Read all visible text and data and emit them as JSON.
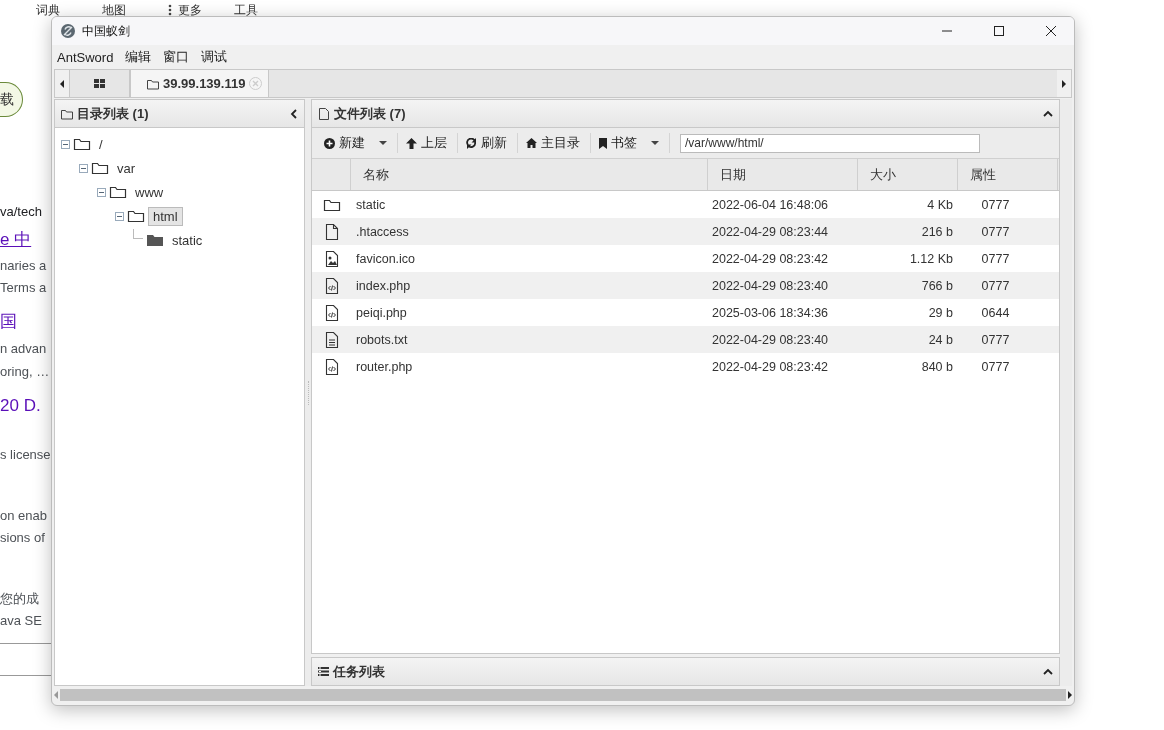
{
  "background_page": {
    "top_links": [
      {
        "label": "词典",
        "kind": "link"
      },
      {
        "label": "地图",
        "kind": "link"
      },
      {
        "label": "更多",
        "kind": "more"
      },
      {
        "label": "工具",
        "kind": "link"
      }
    ],
    "fragments": [
      {
        "text": "载",
        "kind": "pill"
      },
      {
        "text": "va/tech",
        "kind": "url"
      },
      {
        "text": "e 中",
        "kind": "link"
      },
      {
        "text": "naries a",
        "kind": "snippet"
      },
      {
        "text": "Terms a",
        "kind": "snippet"
      },
      {
        "text": "国",
        "kind": "link"
      },
      {
        "text": "n advan",
        "kind": "snippet"
      },
      {
        "text": "oring, …",
        "kind": "snippet"
      },
      {
        "text": "20 D.",
        "kind": "link"
      },
      {
        "text": "s license",
        "kind": "snippet"
      },
      {
        "text": "on enab",
        "kind": "snippet"
      },
      {
        "text": "sions of",
        "kind": "snippet"
      },
      {
        "text": "您的成",
        "kind": "snippet"
      },
      {
        "text": "ava SE",
        "kind": "snippet"
      }
    ]
  },
  "window": {
    "title": "中国蚁剑",
    "menu": [
      "AntSword",
      "编辑",
      "窗口",
      "调试"
    ],
    "tabs": [
      {
        "kind": "home",
        "selected": false
      },
      {
        "kind": "site",
        "label": "39.99.139.119",
        "selected": true
      }
    ],
    "left_panel": {
      "title": "目录列表 (1)",
      "tree": [
        {
          "label": "/",
          "expanded": true,
          "selected": false,
          "children": [
            {
              "label": "var",
              "expanded": true,
              "selected": false,
              "children": [
                {
                  "label": "www",
                  "expanded": true,
                  "selected": false,
                  "children": [
                    {
                      "label": "html",
                      "expanded": true,
                      "selected": true,
                      "children": [
                        {
                          "label": "static",
                          "expanded": false,
                          "selected": false
                        }
                      ]
                    }
                  ]
                }
              ]
            }
          ]
        }
      ]
    },
    "right_panel": {
      "title": "文件列表 (7)",
      "toolbar": [
        {
          "label": "新建",
          "kind": "new",
          "dropdown": true
        },
        {
          "label": "上层",
          "kind": "up",
          "dropdown": false
        },
        {
          "label": "刷新",
          "kind": "refresh",
          "dropdown": false
        },
        {
          "label": "主目录",
          "kind": "home",
          "dropdown": false
        },
        {
          "label": "书签",
          "kind": "bookmark",
          "dropdown": true
        }
      ],
      "path": "/var/www/html/",
      "columns": [
        "名称",
        "日期",
        "大小",
        "属性"
      ],
      "rows": [
        {
          "kind": "folder",
          "name": "static",
          "date": "2022-06-04 16:48:06",
          "size": "4 Kb",
          "perms": "0777"
        },
        {
          "kind": "file",
          "name": ".htaccess",
          "date": "2022-04-29 08:23:44",
          "size": "216 b",
          "perms": "0777"
        },
        {
          "kind": "image",
          "name": "favicon.ico",
          "date": "2022-04-29 08:23:42",
          "size": "1.12 Kb",
          "perms": "0777"
        },
        {
          "kind": "code",
          "name": "index.php",
          "date": "2022-04-29 08:23:40",
          "size": "766 b",
          "perms": "0777"
        },
        {
          "kind": "code",
          "name": "peiqi.php",
          "date": "2025-03-06 18:34:36",
          "size": "29 b",
          "perms": "0644"
        },
        {
          "kind": "text",
          "name": "robots.txt",
          "date": "2022-04-29 08:23:40",
          "size": "24 b",
          "perms": "0777"
        },
        {
          "kind": "code",
          "name": "router.php",
          "date": "2022-04-29 08:23:42",
          "size": "840 b",
          "perms": "0777"
        }
      ]
    },
    "task_panel": {
      "title": "任务列表"
    }
  }
}
